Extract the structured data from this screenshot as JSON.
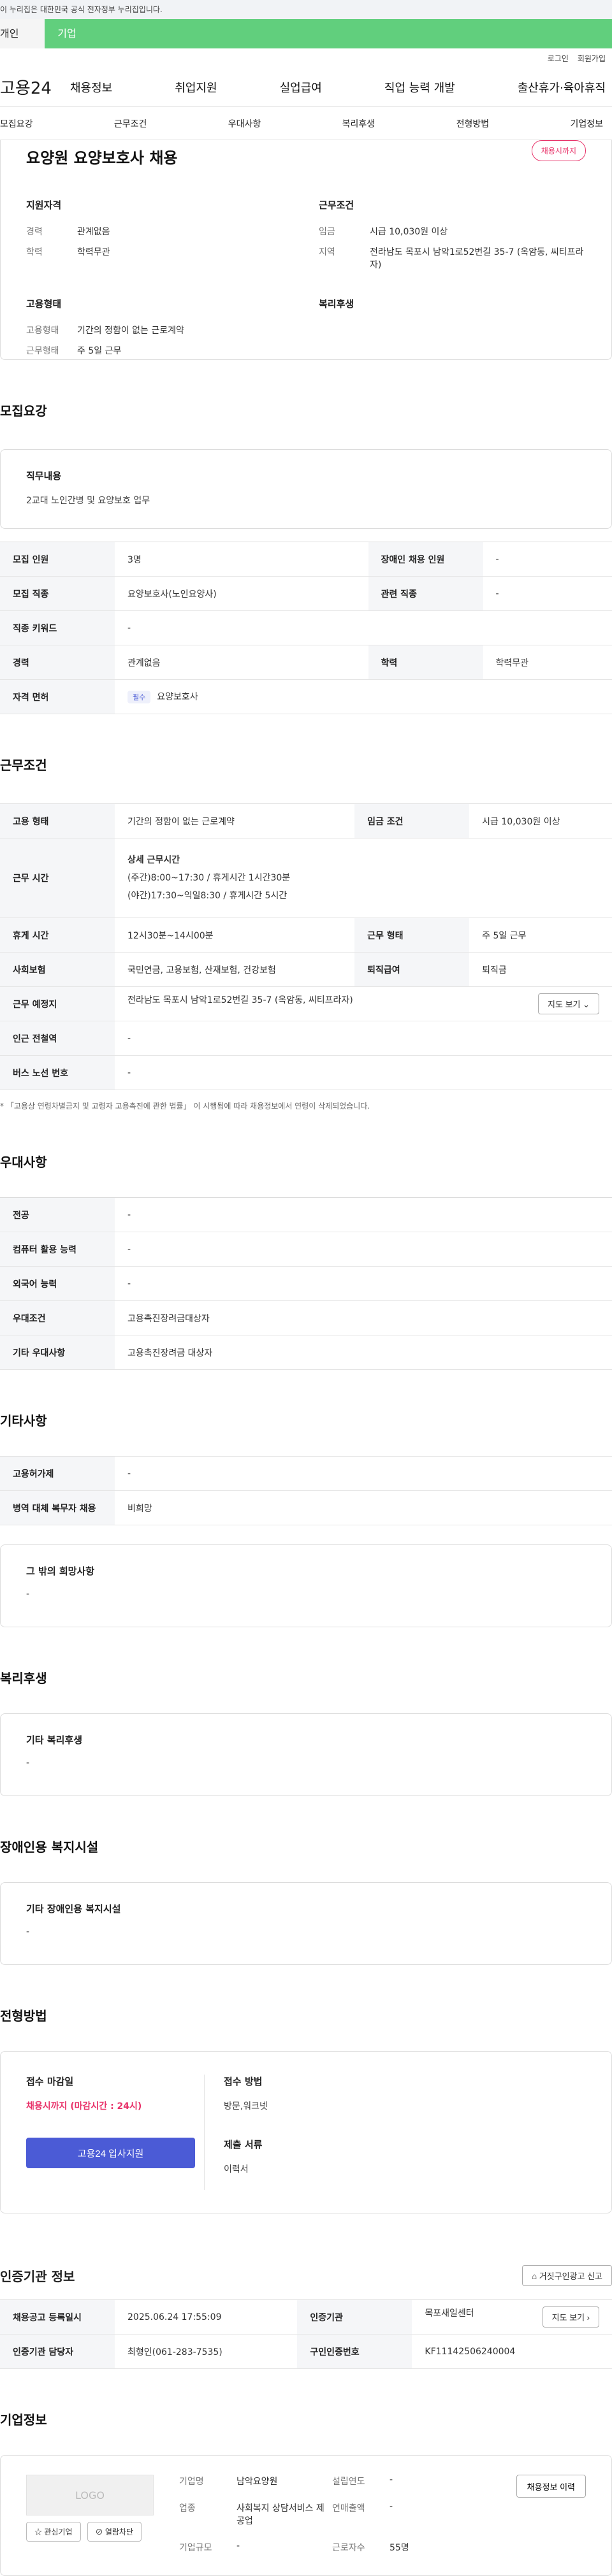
{
  "banner": "이 누리집은 대한민국 공식 전자정부 누리집입니다.",
  "tabs": {
    "personal": "개인",
    "business": "기업"
  },
  "util": {
    "login": "로그인",
    "signup": "회원가입"
  },
  "gnb": {
    "logo": "고용24",
    "menu": [
      "채용정보",
      "취업지원",
      "실업급여",
      "직업 능력 개발",
      "출산휴가·육아휴직"
    ]
  },
  "anchors": [
    "모집요강",
    "근무조건",
    "우대사항",
    "복리후생",
    "전형방법",
    "기업정보"
  ],
  "summary": {
    "title": "요양원 요양보호사 채용",
    "badge": "채용시까지",
    "qual_head": "지원자격",
    "qual": [
      {
        "k": "경력",
        "v": "관계없음"
      },
      {
        "k": "학력",
        "v": "학력무관"
      }
    ],
    "cond_head": "근무조건",
    "cond": [
      {
        "k": "임금",
        "v": "시급 10,030원 이상"
      },
      {
        "k": "지역",
        "v": "전라남도 목포시 남악1로52번길 35-7 (옥암동, 씨티프라자)"
      }
    ],
    "emp_head": "고용형태",
    "emp": [
      {
        "k": "고용형태",
        "v": "기간의 정함이 없는 근로계약"
      },
      {
        "k": "근무형태",
        "v": "주 5일 근무"
      }
    ],
    "welfare_head": "복리후생"
  },
  "recruit": {
    "title": "모집요강",
    "job_head": "직무내용",
    "job_desc": "2교대 노인간병 및 요양보호 업무",
    "rows": [
      [
        {
          "k": "모집 인원",
          "v": "3명"
        },
        {
          "k": "장애인 채용 인원",
          "v": "-"
        }
      ],
      [
        {
          "k": "모집 직종",
          "v": "요양보호사(노인요양사)"
        },
        {
          "k": "관련 직종",
          "v": "-"
        }
      ],
      [
        {
          "k": "직종 키워드",
          "v": "-"
        }
      ],
      [
        {
          "k": "경력",
          "v": "관계없음"
        },
        {
          "k": "학력",
          "v": "학력무관"
        }
      ]
    ],
    "license_k": "자격 면허",
    "license_chip": "필수",
    "license_v": "요양보호사"
  },
  "work": {
    "title": "근무조건",
    "emp_k": "고용 형태",
    "emp_v": "기간의 정함이 없는 근로계약",
    "wage_k": "임금 조건",
    "wage_v": "시급 10,030원 이상",
    "time_k": "근무 시간",
    "time_head": "상세 근무시간",
    "time_1": "(주간)8:00~17:30 / 휴게시간 1시간30분",
    "time_2": "(야간)17:30~익일8:30 / 휴게시간 5시간",
    "rest_k": "휴게 시간",
    "rest_v": "12시30분~14시00분",
    "form_k": "근무 형태",
    "form_v": "주 5일 근무",
    "ins_k": "사회보험",
    "ins_v": "국민연금, 고용보험, 산재보험, 건강보험",
    "sev_k": "퇴직급여",
    "sev_v": "퇴직금",
    "place_k": "근무 예정지",
    "place_v": "전라남도 목포시 남악1로52번길 35-7 (옥암동, 씨티프라자)",
    "map_btn": "지도 보기 ⌄",
    "sub_k": "인근 전철역",
    "sub_v": "-",
    "bus_k": "버스 노선 번호",
    "bus_v": "-",
    "note": "* 「고용상 연령차별금지 및 고령자 고용촉진에 관한 법률」 이 시행됨에 따라 채용정보에서 연령이 삭제되었습니다."
  },
  "pref": {
    "title": "우대사항",
    "rows": [
      {
        "k": "전공",
        "v": "-"
      },
      {
        "k": "컴퓨터 활용 능력",
        "v": "-"
      },
      {
        "k": "외국어 능력",
        "v": "-"
      },
      {
        "k": "우대조건",
        "v": "고용촉진장려금대상자"
      },
      {
        "k": "기타 우대사항",
        "v": "고용촉진장려금 대상자"
      }
    ]
  },
  "etc": {
    "title": "기타사항",
    "rows": [
      {
        "k": "고용허가제",
        "v": "-"
      },
      {
        "k": "병역 대체 복무자 채용",
        "v": "비희망"
      }
    ],
    "wish_head": "그 밖의 희망사항",
    "wish_v": "-"
  },
  "welfare": {
    "title": "복리후생",
    "head": "기타 복리후생",
    "v": "-"
  },
  "disabled": {
    "title": "장애인용 복지시설",
    "head": "기타 장애인용 복지시설",
    "v": "-"
  },
  "apply": {
    "title": "전형방법",
    "deadline_head": "접수 마감일",
    "deadline_v": "채용시까지 (마감시간 : 24시)",
    "btn": "고용24 입사지원",
    "method_head": "접수 방법",
    "method_v": "방문,워크넷",
    "docs_head": "제출 서류",
    "docs_v": "이력서"
  },
  "agency": {
    "title": "인증기관 정보",
    "report_btn": "⌂ 거짓구인광고 신고",
    "reg_k": "채용공고 등록일시",
    "reg_v": "2025.06.24 17:55:09",
    "org_k": "인증기관",
    "org_v": "목포새일센터",
    "map_btn": "지도 보기 ›",
    "mgr_k": "인증기관 담당자",
    "mgr_v": "최형인(061-283-7535)",
    "no_k": "구인인증번호",
    "no_v": "KF11142506240004"
  },
  "company": {
    "title": "기업정보",
    "logo": "LOGO",
    "fav_btn": "☆ 관심기업",
    "block_btn": "⊘ 열람차단",
    "name_k": "기업명",
    "name_v": "남악요양원",
    "year_k": "설립연도",
    "year_v": "-",
    "biz_k": "업종",
    "biz_v": "사회복지 상담서비스 제공업",
    "sales_k": "연매출액",
    "sales_v": "-",
    "emp_k": "근로자수",
    "emp_v": "55명",
    "size_k": "기업규모",
    "size_v": "-",
    "history_btn": "채용정보 이력"
  }
}
